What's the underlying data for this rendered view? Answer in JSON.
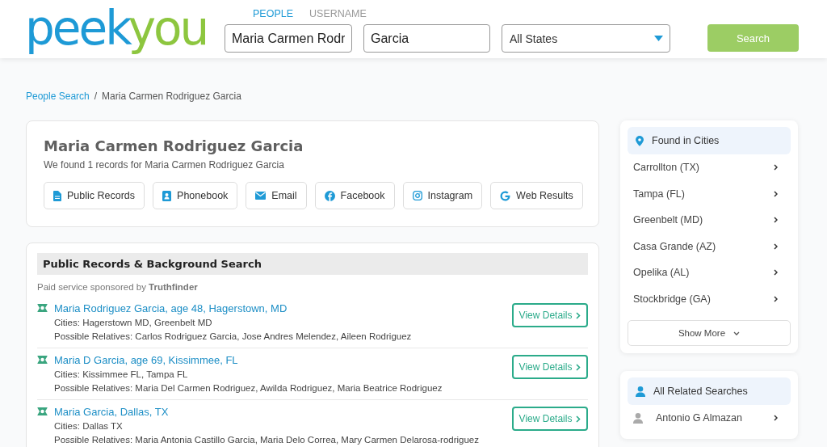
{
  "logo": {
    "part_1": "peek",
    "part_2": "you"
  },
  "search_tabs": [
    {
      "label": "PEOPLE",
      "selected": true
    },
    {
      "label": "USERNAME",
      "selected": false
    }
  ],
  "first_name": {
    "value": "Maria Carmen Rodr"
  },
  "last_name": {
    "value": "Garcia"
  },
  "state_select": {
    "value": "All States"
  },
  "search_button": "Search",
  "breadcrumb": {
    "link": "People Search",
    "separator": "/",
    "current": "Maria Carmen Rodriguez Garcia"
  },
  "profile": {
    "name": "Maria Carmen Rodriguez Garcia",
    "summary": "We found 1 records for Maria Carmen Rodriguez Garcia",
    "buttons": [
      {
        "label": "Public Records",
        "kind": "records"
      },
      {
        "label": "Phonebook",
        "kind": "phonebook"
      },
      {
        "label": "Email",
        "kind": "email"
      },
      {
        "label": "Facebook",
        "kind": "facebook"
      },
      {
        "label": "Instagram",
        "kind": "instagram"
      },
      {
        "label": "Web Results",
        "kind": "web"
      }
    ]
  },
  "records": {
    "title": "Public Records & Background Search",
    "sponsor": "Paid service sponsored by **Truthfinder**",
    "results": [
      {
        "title": "Maria Rodriguez Garcia, age 48, Hagerstown, MD",
        "cities": "Cities: Hagerstown MD, Greenbelt MD",
        "relatives": "Possible Relatives: Carlos Rodriguez Garcia, Jose Andres Melendez, Aileen Rodriguez",
        "button": "View Details"
      },
      {
        "title": "Maria D Garcia, age 69, Kissimmee, FL",
        "cities": "Cities: Kissimmee FL, Tampa FL",
        "relatives": "Possible Relatives: Maria Del Carmen Rodriguez, Awilda Rodriguez, Maria Beatrice Rodriguez",
        "button": "View Details"
      },
      {
        "title": "Maria Garcia, Dallas, TX",
        "cities": "Cities: Dallas TX",
        "relatives": "Possible Relatives: Maria Antonia Castillo Garcia, Maria Delo Correa, Mary Carmen Delarosa-rodriguez",
        "button": "View Details"
      }
    ]
  },
  "cities": {
    "title": "Found in Cities",
    "items": [
      "Carrollton (TX)",
      "Tampa (FL)",
      "Greenbelt (MD)",
      "Casa Grande (AZ)",
      "Opelika (AL)",
      "Stockbridge (GA)"
    ],
    "show_more": "Show More"
  },
  "related": {
    "title": "All Related Searches",
    "items": [
      "Antonio G Almazan"
    ]
  }
}
